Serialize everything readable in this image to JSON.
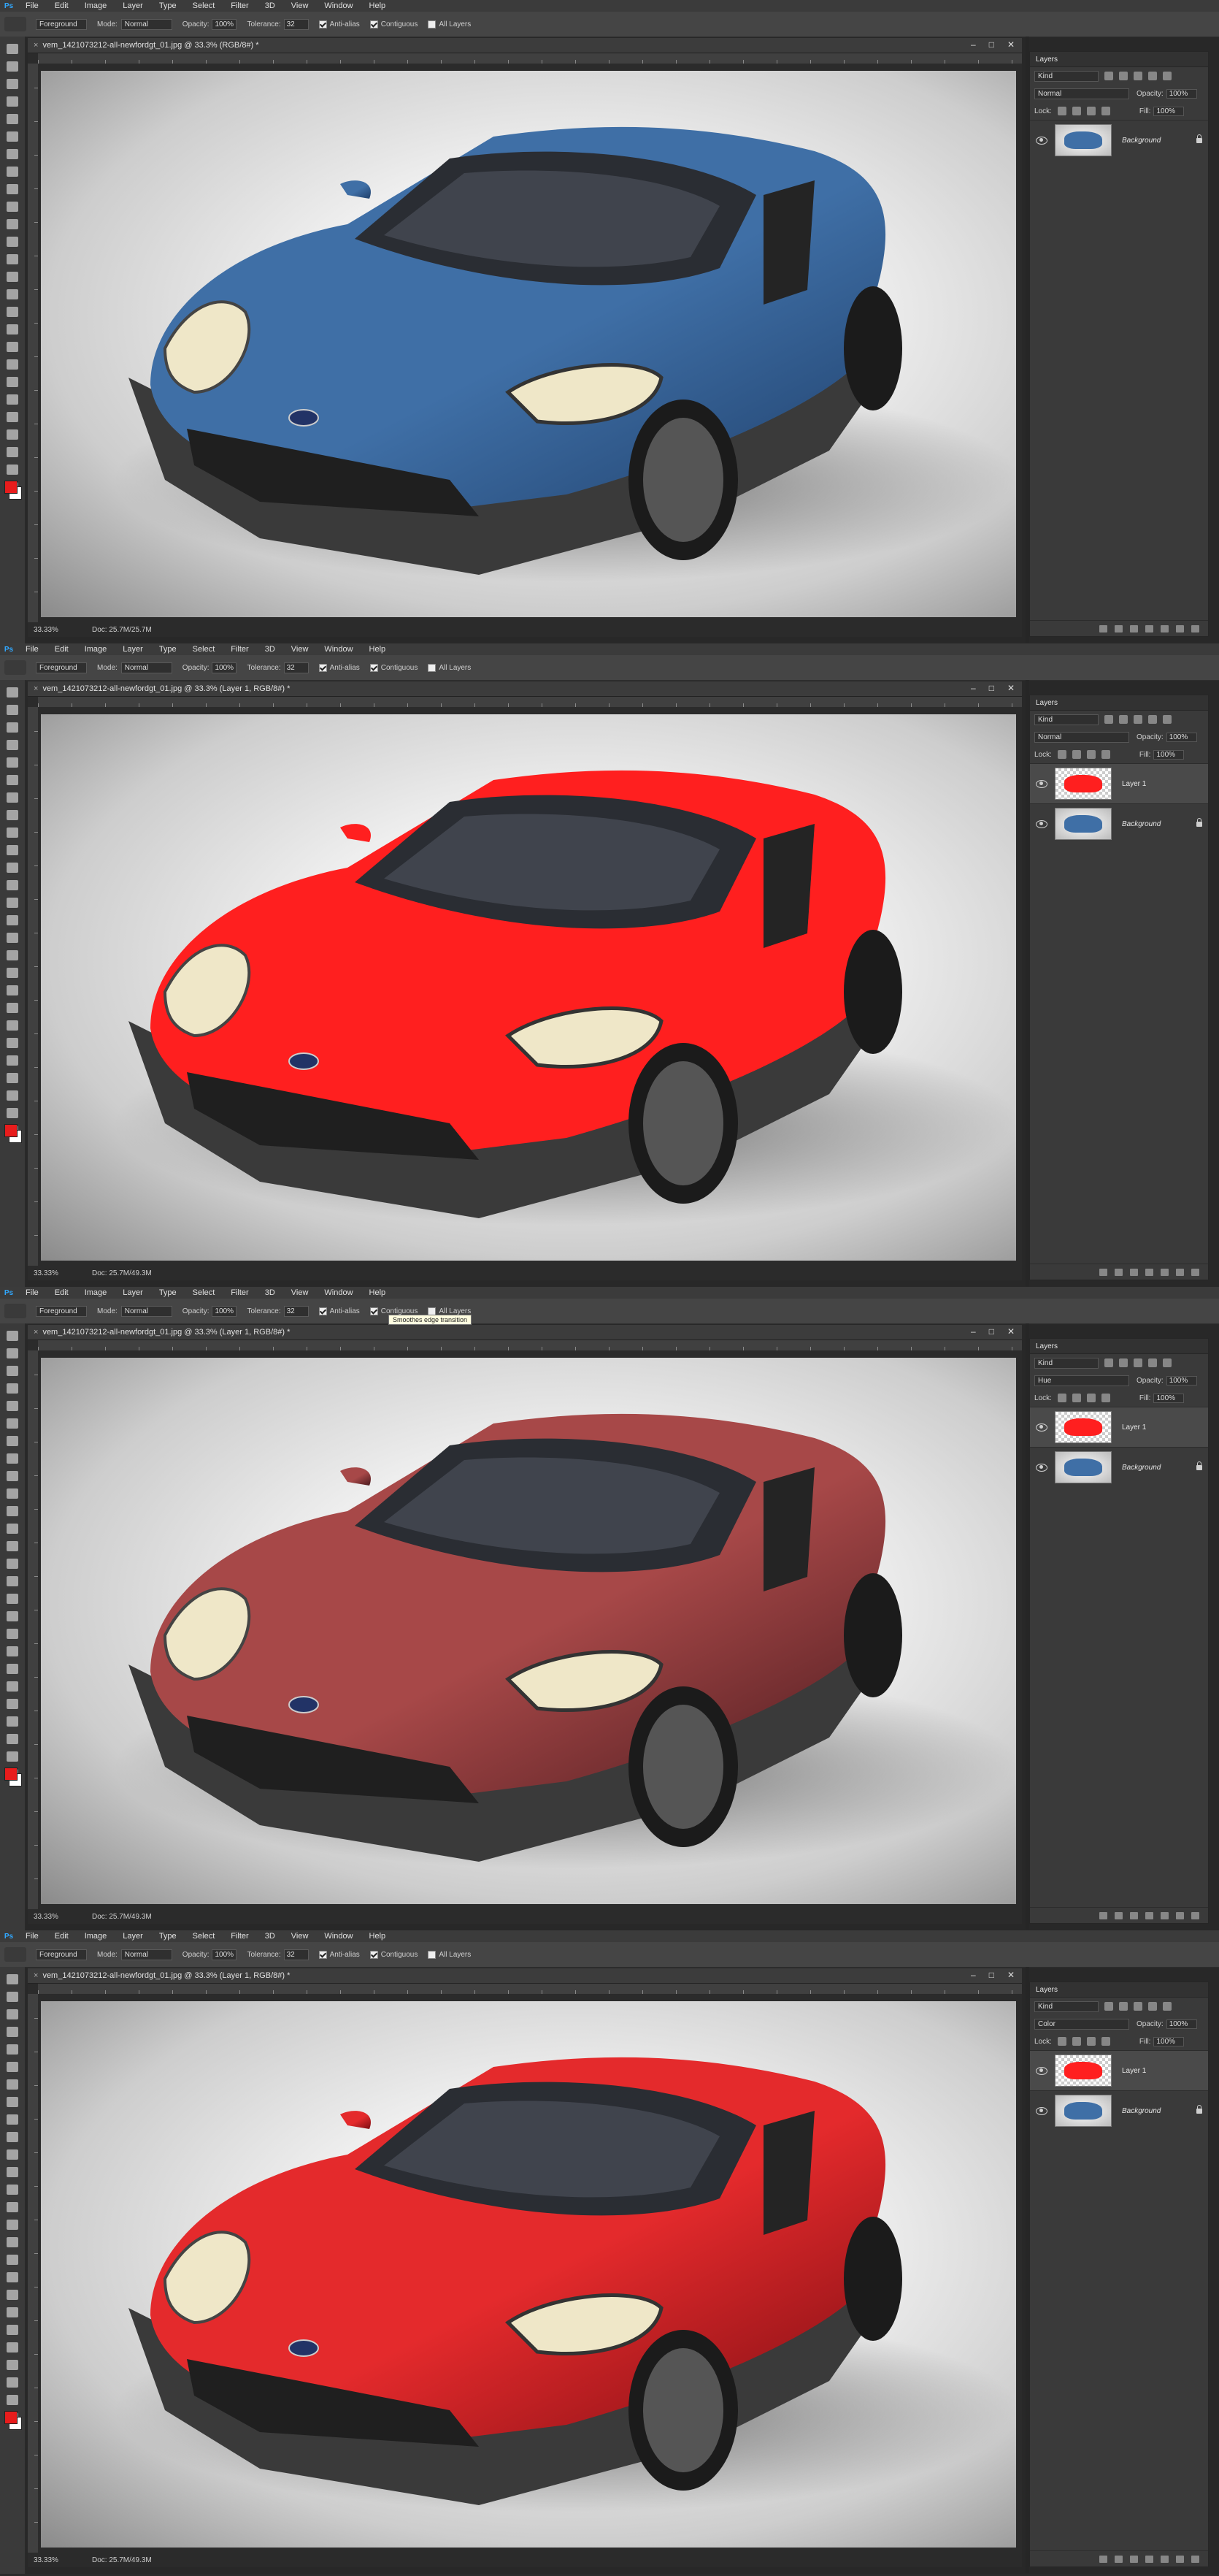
{
  "app": {
    "menu": [
      "File",
      "Edit",
      "Image",
      "Layer",
      "Type",
      "Select",
      "Filter",
      "3D",
      "View",
      "Window",
      "Help"
    ],
    "ps_logo": "Ps"
  },
  "options": {
    "fill_label": "Foreground",
    "mode_label": "Mode:",
    "mode_value": "Normal",
    "opacity_label": "Opacity:",
    "opacity_value": "100%",
    "tolerance_label": "Tolerance:",
    "tolerance_value": "32",
    "antialias": "Anti-alias",
    "contiguous": "Contiguous",
    "all_layers": "All Layers"
  },
  "statusbar": {
    "zoom": "33.33%"
  },
  "layers_panel": {
    "tab": "Layers",
    "kind": "Kind",
    "opacity_label": "Opacity:",
    "fill_label": "Fill:",
    "lock_label": "Lock:",
    "percent": "100%"
  },
  "frames": [
    {
      "doc_title": "vem_1421073212-all-newfordgt_01.jpg @ 33.3% (RGB/8#) *",
      "doc_size": "Doc: 25.7M/25.7M",
      "car_color": "#3f6fa6",
      "car_shade": "#1f3f6a",
      "blend_mode": "Normal",
      "layers": [
        {
          "name": "Background",
          "type": "background"
        }
      ]
    },
    {
      "doc_title": "vem_1421073212-all-newfordgt_01.jpg @ 33.3% (Layer 1, RGB/8#) *",
      "doc_size": "Doc: 25.7M/49.3M",
      "car_color": "#ff1f1f",
      "car_shade": "#ff1f1f",
      "blend_mode": "Normal",
      "layers": [
        {
          "name": "Layer 1",
          "type": "layer"
        },
        {
          "name": "Background",
          "type": "background"
        }
      ]
    },
    {
      "doc_title": "vem_1421073212-all-newfordgt_01.jpg @ 33.3% (Layer 1, RGB/8#) *",
      "doc_size": "Doc: 25.7M/49.3M",
      "car_color": "#a74848",
      "car_shade": "#4a1a1e",
      "blend_mode": "Hue",
      "tooltip": "Smoothes edge transition",
      "layers": [
        {
          "name": "Layer 1",
          "type": "layer"
        },
        {
          "name": "Background",
          "type": "background"
        }
      ]
    },
    {
      "doc_title": "vem_1421073212-all-newfordgt_01.jpg @ 33.3% (Layer 1, RGB/8#) *",
      "doc_size": "Doc: 25.7M/49.3M",
      "car_color": "#e42a2c",
      "car_shade": "#7a0d12",
      "blend_mode": "Color",
      "layers": [
        {
          "name": "Layer 1",
          "type": "layer"
        },
        {
          "name": "Background",
          "type": "background"
        }
      ]
    }
  ]
}
